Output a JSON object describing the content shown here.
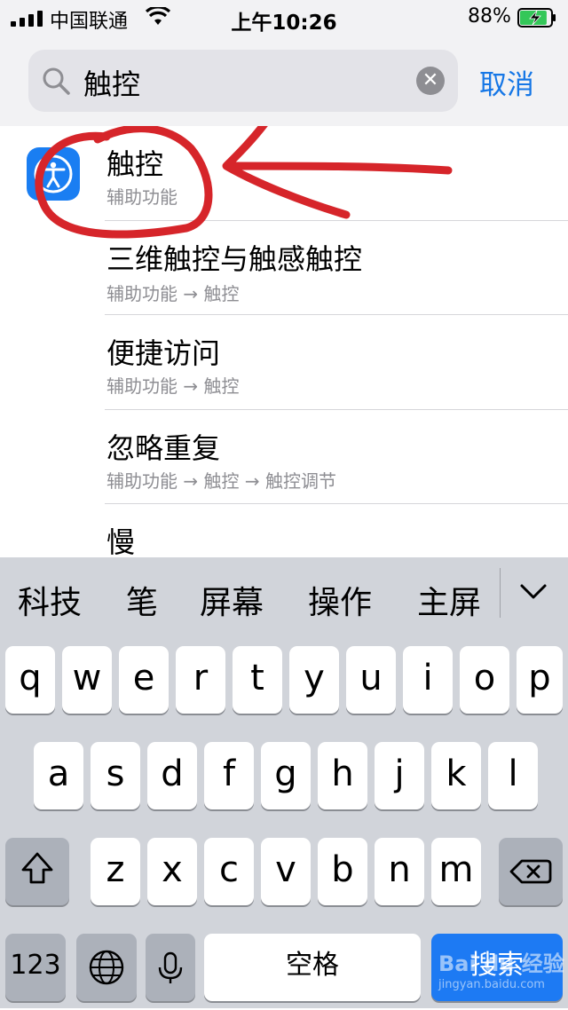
{
  "status": {
    "carrier": "中国联通",
    "time": "上午10:26",
    "battery_pct": "88%",
    "battery_level": 0.88
  },
  "search": {
    "query": "触控",
    "cancel_label": "取消"
  },
  "results": [
    {
      "title": "触控",
      "subtitle": "辅助功能"
    },
    {
      "title": "三维触控与触感触控",
      "subtitle": "辅助功能 → 触控"
    },
    {
      "title": "便捷访问",
      "subtitle": "辅助功能 → 触控"
    },
    {
      "title": "忽略重复",
      "subtitle": "辅助功能 → 触控 → 触控调节"
    },
    {
      "title": "慢",
      "subtitle": ""
    }
  ],
  "candidates": [
    "科技",
    "笔",
    "屏幕",
    "操作",
    "主屏"
  ],
  "keyboard": {
    "row1": [
      "q",
      "w",
      "e",
      "r",
      "t",
      "y",
      "u",
      "i",
      "o",
      "p"
    ],
    "row2": [
      "a",
      "s",
      "d",
      "f",
      "g",
      "h",
      "j",
      "k",
      "l"
    ],
    "row3": [
      "z",
      "x",
      "c",
      "v",
      "b",
      "n",
      "m"
    ],
    "numbers_label": "123",
    "space_label": "空格",
    "search_label": "搜索"
  },
  "watermark": {
    "brand": "Bai du 经验",
    "url": "jingyan.baidu.com"
  },
  "colors": {
    "accent": "#1677e6",
    "app_icon": "#1a7ef2",
    "annotation": "#d6252a",
    "key_blue": "#1d7af3"
  }
}
